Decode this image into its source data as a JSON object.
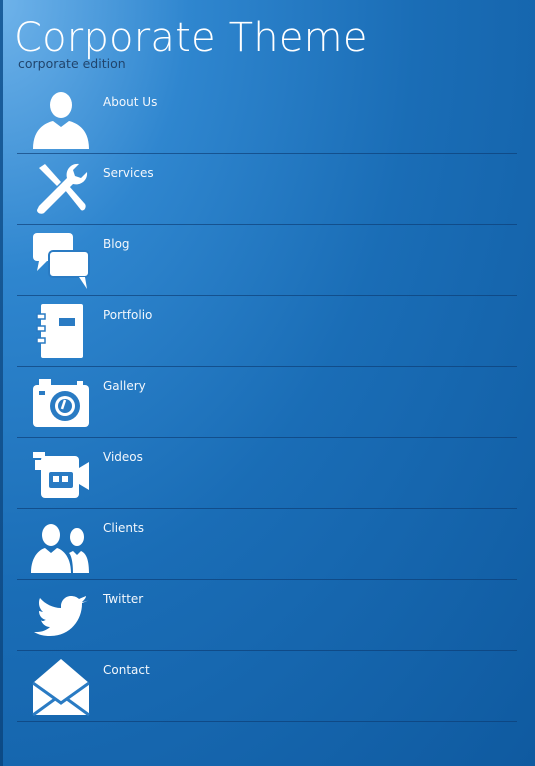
{
  "header": {
    "title": "Corporate Theme",
    "subtitle": "corporate edition"
  },
  "menu": {
    "items": [
      {
        "label": "About Us",
        "icon": "user-icon"
      },
      {
        "label": "Services",
        "icon": "tools-icon"
      },
      {
        "label": "Blog",
        "icon": "chat-bubbles-icon"
      },
      {
        "label": "Portfolio",
        "icon": "notebook-icon"
      },
      {
        "label": "Gallery",
        "icon": "camera-icon"
      },
      {
        "label": "Videos",
        "icon": "video-camera-icon"
      },
      {
        "label": "Clients",
        "icon": "users-icon"
      },
      {
        "label": "Twitter",
        "icon": "twitter-bird-icon"
      },
      {
        "label": "Contact",
        "icon": "envelope-icon"
      }
    ]
  },
  "colors": {
    "background_start": "#6fb3ea",
    "background_end": "#0f5aa0",
    "subtitle": "#21456d",
    "divider": "#0c3c73"
  }
}
